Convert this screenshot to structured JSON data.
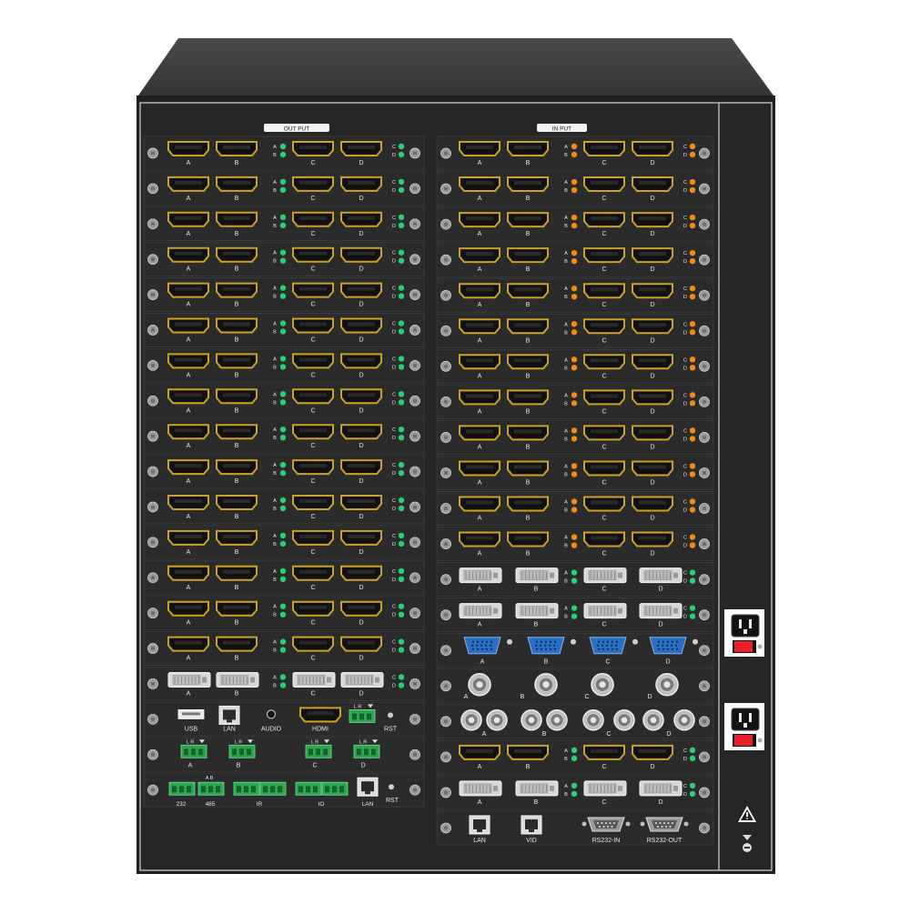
{
  "labels": {
    "output": "OUT PUT",
    "input": "IN PUT",
    "ports": [
      "A",
      "B",
      "C",
      "D"
    ],
    "led_ab": [
      "A",
      "B"
    ],
    "led_cd": [
      "C",
      "D"
    ],
    "usb": "USB",
    "lan": "LAN",
    "audio": "AUDIO",
    "hdmi": "HDMI",
    "rst": "RST",
    "lr": "L R",
    "ab": "A B",
    "p232": "232",
    "p485": "485",
    "ir": "IR",
    "io": "IO",
    "vid": "VID",
    "rs232_in": "RS232-IN",
    "rs232_out": "RS232-OUT"
  },
  "output_rows": [
    "hdmi",
    "hdmi",
    "hdmi",
    "hdmi",
    "hdmi",
    "hdmi",
    "hdmi",
    "hdmi",
    "hdmi",
    "hdmi",
    "hdmi",
    "hdmi",
    "hdmi",
    "hdmi",
    "hdmi",
    "dvi",
    "control",
    "audio",
    "terminal"
  ],
  "input_rows": [
    "hdmi",
    "hdmi",
    "hdmi",
    "hdmi",
    "hdmi",
    "hdmi",
    "hdmi",
    "hdmi",
    "hdmi",
    "hdmi",
    "hdmi",
    "hdmi",
    "dvi",
    "dvi",
    "vga",
    "bnc",
    "bnc-pair",
    "hdmi",
    "dvi",
    "network"
  ],
  "colors": {
    "chassis_top": "#3c3c3c",
    "face": "#242424",
    "panel": "#2e2e2e",
    "hdmi": "#c9a227",
    "led_green": "#2ecc71",
    "led_orange": "#f08a1a",
    "vga_blue": "#2a6fc2",
    "terminal_green": "#2ea44f",
    "power_red": "#e8202a"
  }
}
